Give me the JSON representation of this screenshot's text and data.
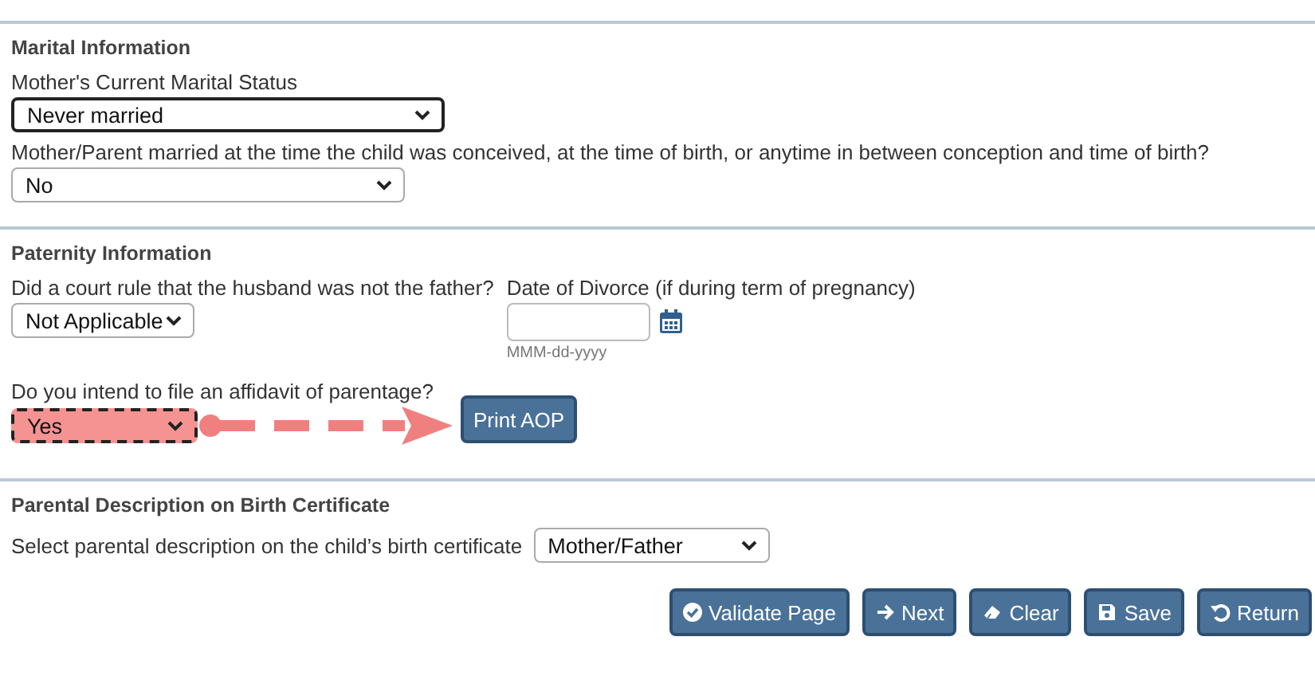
{
  "sections": [
    {
      "title": "Marital Information",
      "fields": [
        {
          "kind": "select",
          "label": "Mother's Current Marital Status",
          "value": "Never married",
          "focused": true
        },
        {
          "kind": "select",
          "label": "Mother/Parent married at the time the child was conceived, at the time of birth, or anytime in between conception and time of birth?",
          "value": "No"
        }
      ]
    },
    {
      "title": "Paternity Information",
      "rows": [
        [
          {
            "kind": "select",
            "label": "Did a court rule that the husband was not the father?",
            "value": "Not Applicable"
          },
          {
            "kind": "date",
            "label": "Date of Divorce (if during term of pregnancy)",
            "hint": "MMM-dd-yyyy"
          }
        ],
        [
          {
            "kind": "select",
            "label": "Do you intend to file an affidavit of parentage?",
            "value": "Yes",
            "highlighted": true,
            "action": "Print AOP"
          }
        ]
      ]
    },
    {
      "title": "Parental Description on Birth Certificate",
      "inline": [
        {
          "kind": "select",
          "label": "Select parental description on the child’s birth certificate",
          "value": "Mother/Father"
        }
      ]
    }
  ],
  "buttons": [
    {
      "label": "Validate Page"
    },
    {
      "label": "Next"
    },
    {
      "label": "Clear"
    },
    {
      "label": "Save"
    },
    {
      "label": "Return"
    }
  ]
}
